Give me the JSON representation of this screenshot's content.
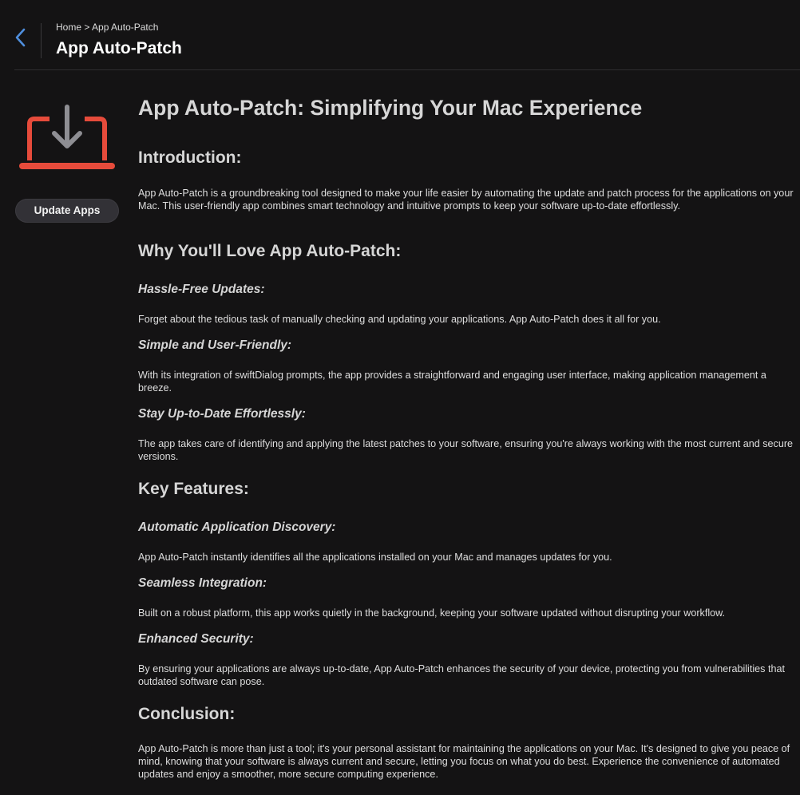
{
  "header": {
    "back_icon": "chevron-left-icon",
    "breadcrumb": {
      "home": "Home",
      "separator": " > ",
      "current": "App Auto-Patch"
    },
    "title": "App Auto-Patch"
  },
  "sidebar": {
    "icon": "laptop-download-icon",
    "icon_color": "#e64b3b",
    "icon_arrow_color": "#8e8e93",
    "update_button_label": "Update Apps"
  },
  "article": {
    "title": "App Auto-Patch: Simplifying Your Mac Experience",
    "intro_heading": "Introduction:",
    "intro_text": "App Auto-Patch is a groundbreaking tool designed to make your life easier by automating the update and patch process for the applications on your Mac. This user-friendly app combines smart technology and intuitive prompts to keep your software up-to-date effortlessly.",
    "why_heading": "Why You'll Love App Auto-Patch:",
    "why_items": [
      {
        "title": "Hassle-Free Updates:",
        "text": "Forget about the tedious task of manually checking and updating your applications. App Auto-Patch does it all for you."
      },
      {
        "title": "Simple and User-Friendly:",
        "text": "With its integration of swiftDialog prompts, the app provides a straightforward and engaging user interface, making application management a breeze."
      },
      {
        "title": "Stay Up-to-Date Effortlessly:",
        "text": "The app takes care of identifying and applying the latest patches to your software, ensuring you're always working with the most current and secure versions."
      }
    ],
    "features_heading": "Key Features:",
    "features_items": [
      {
        "title": "Automatic Application Discovery:",
        "text": "App Auto-Patch instantly identifies all the applications installed on your Mac and manages updates for you."
      },
      {
        "title": "Seamless Integration:",
        "text": "Built on a robust platform, this app works quietly in the background, keeping your software updated without disrupting your workflow."
      },
      {
        "title": "Enhanced Security:",
        "text": "By ensuring your applications are always up-to-date, App Auto-Patch enhances the security of your device, protecting you from vulnerabilities that outdated software can pose."
      }
    ],
    "conclusion_heading": "Conclusion:",
    "conclusion_text": "App Auto-Patch is more than just a tool; it's your personal assistant for maintaining the applications on your Mac. It's designed to give you peace of mind, knowing that your software is always current and secure, letting you focus on what you do best. Experience the convenience of automated updates and enjoy a smoother, more secure computing experience."
  }
}
